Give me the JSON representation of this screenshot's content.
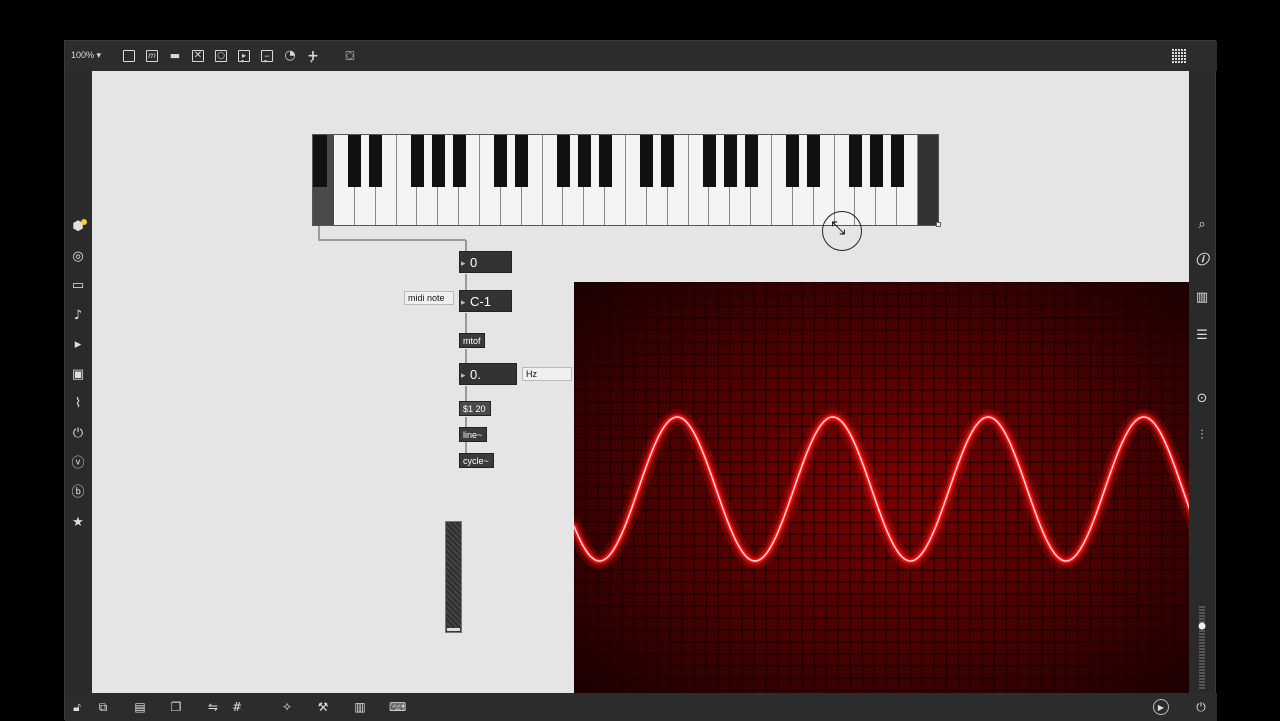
{
  "toolbar": {
    "zoom_label": "100%",
    "zoom_caret": "▾",
    "icons": [
      "new-object-icon",
      "message-icon",
      "comment-icon",
      "toggle-icon",
      "button-icon",
      "number-icon",
      "slider-icon",
      "dial-icon",
      "add-icon",
      "paint-bucket-icon"
    ]
  },
  "patch": {
    "number_midi": "0",
    "number_note": "C-1",
    "comment_midi": "midi note",
    "obj_mtof": "mtof",
    "number_hz": "0.",
    "comment_hz": "Hz",
    "msg_ramp": "$1 20",
    "obj_line": "line~",
    "obj_cycle": "cycle~",
    "slider_value": 0
  },
  "keyboard": {
    "white_keys": 28,
    "octaves": 4
  },
  "scope": {
    "cycles": 4,
    "color": "#ff1010"
  },
  "colors": {
    "canvas": "#e5e5e5",
    "chrome": "#2c2c2c",
    "accent_yellow": "#f5d020"
  }
}
